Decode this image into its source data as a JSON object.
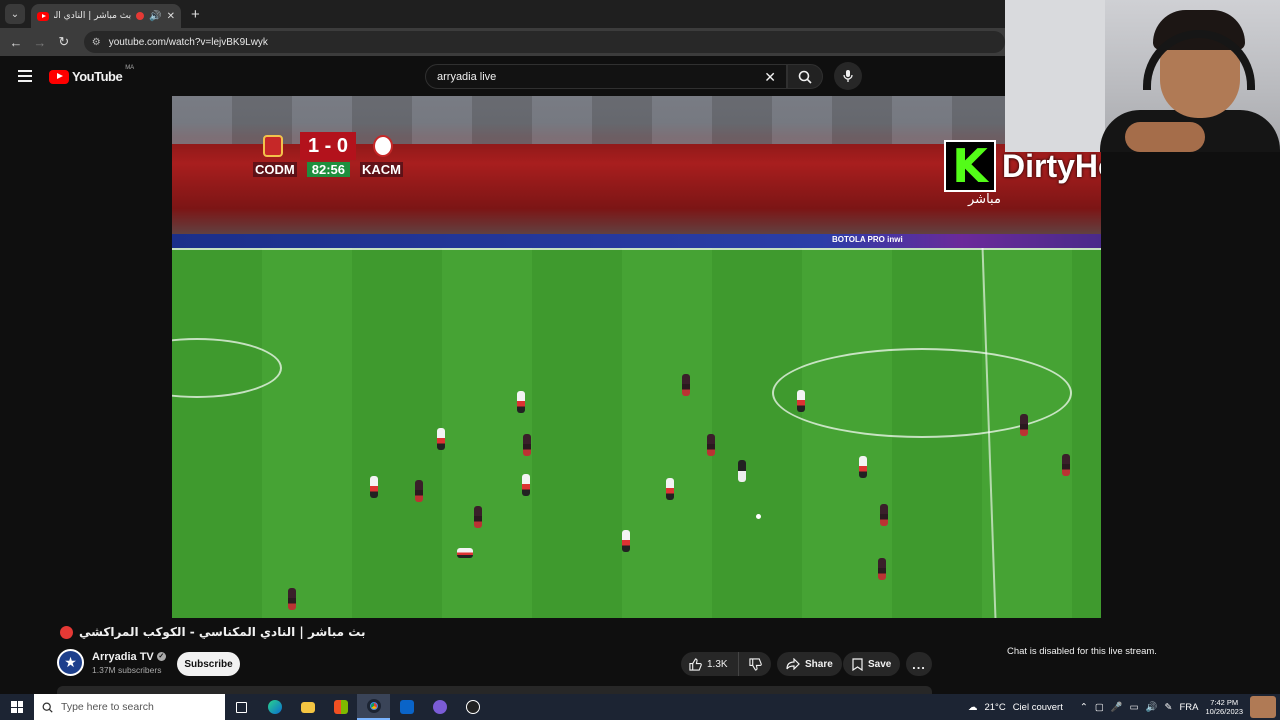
{
  "browser": {
    "tab_title": "بث مباشر | النادي المكناسي",
    "url": "youtube.com/watch?v=lejvBK9Lwyk",
    "new_tab_symbol": "+",
    "tab_close": "✕"
  },
  "youtube": {
    "logo_text": "YouTube",
    "country_code": "MA",
    "search_value": "arryadia live"
  },
  "video": {
    "home_team": "CODM",
    "away_team": "KACM",
    "score": "1 - 0",
    "clock": "82:56",
    "ad_board_text": "BOTOLA PRO inwi",
    "overlay_logo_letter": "K",
    "overlay_name": "DirtyHowaAna",
    "overlay_live_label": "مباشر",
    "title": "بث مباشر | النادي المكناسي - الكوكب المراكشي"
  },
  "channel": {
    "name": "Arryadia TV",
    "subscribers": "1.37M subscribers",
    "subscribe_label": "Subscribe"
  },
  "actions": {
    "like_count": "1.3K",
    "share_label": "Share",
    "save_label": "Save",
    "more_label": "..."
  },
  "chat": {
    "disabled_message": "Chat is disabled for this live stream."
  },
  "taskbar": {
    "search_placeholder": "Type here to search",
    "weather_temp": "21°C",
    "weather_text": "Ciel couvert",
    "language": "FRA",
    "time": "7:42 PM",
    "date": "10/26/2023"
  },
  "colors": {
    "accent_red": "#ff0000",
    "kick_green": "#53fc18",
    "clock_green": "#1e8f3e"
  }
}
